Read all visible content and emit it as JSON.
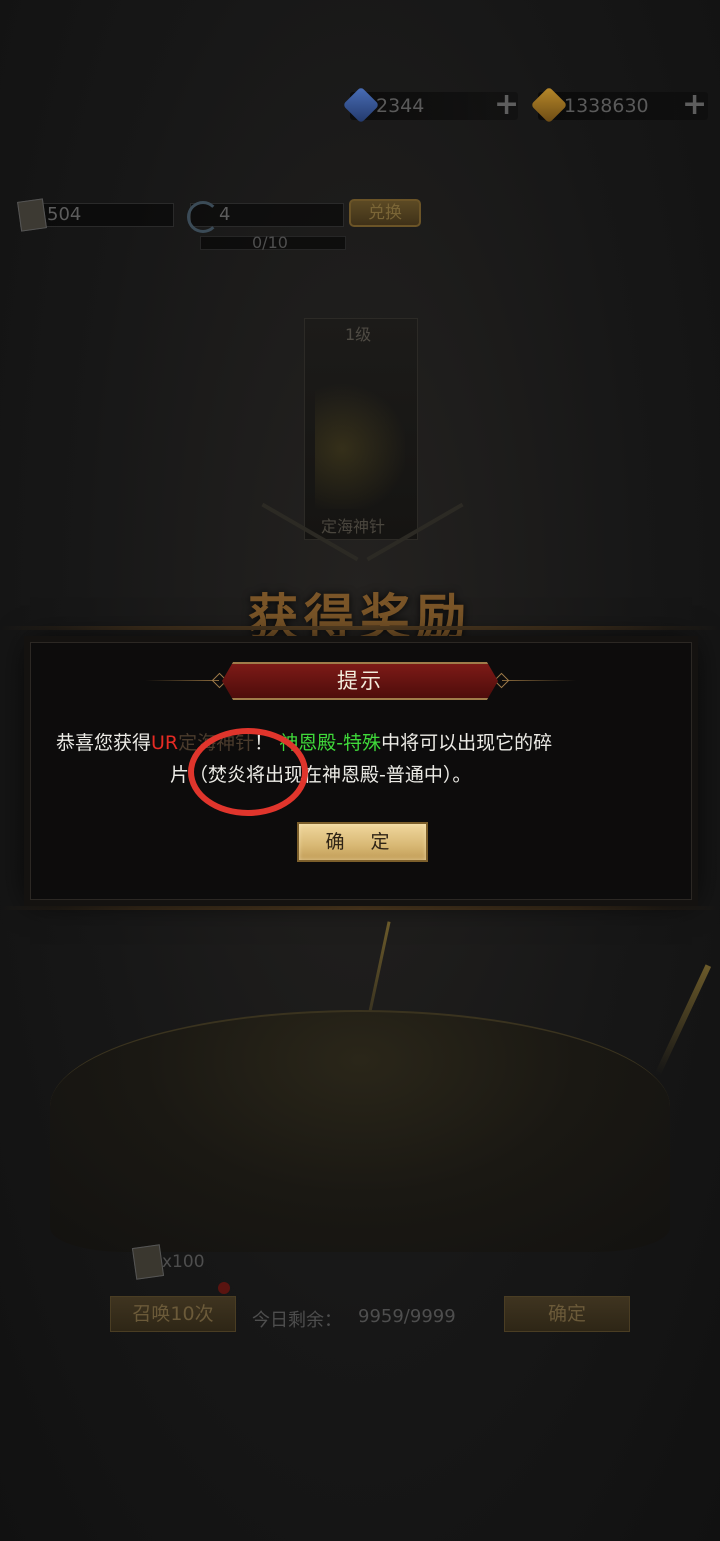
{
  "currencies": {
    "blue_gem": {
      "icon": "blue-gem-icon",
      "value": "2344",
      "add": "+"
    },
    "gold_gem": {
      "icon": "gold-gem-icon",
      "value": "1338630",
      "add": "+"
    }
  },
  "resources": {
    "ticket": {
      "icon": "summon-ticket-icon",
      "value": "504"
    },
    "orb": {
      "icon": "moon-orb-icon",
      "value": "4"
    },
    "progress": "0/10",
    "exchange_label": "兑换"
  },
  "background": {
    "card_level": "1级",
    "card_name": "定海神针",
    "reward_title": "获得奖励"
  },
  "dialog": {
    "title": "提示",
    "line1_prefix": "恭喜您获得",
    "line1_item_shown": "UR",
    "line1_item_obscured": "定海神针",
    "line1_mid": "！",
    "line1_place": "神恩殿-特殊",
    "line1_suffix": "中将可以出现它的碎",
    "line2_prefix": "片（",
    "line2_circled": "焚炎",
    "line2_suffix": "将出现在神恩殿-普通中）。",
    "confirm_label": "确 定"
  },
  "bottom": {
    "ticket_cost": "x100",
    "summon_label": "召唤10次",
    "remaining_label": "今日剩余：",
    "remaining_value": "9959/9999",
    "confirm_label": "确定"
  },
  "colors": {
    "highlight": "#e0352c",
    "item_red": "#e52b24",
    "place_green": "#3fd93a",
    "header_red": "#7d1a17",
    "button_gold": "#d8b874"
  }
}
